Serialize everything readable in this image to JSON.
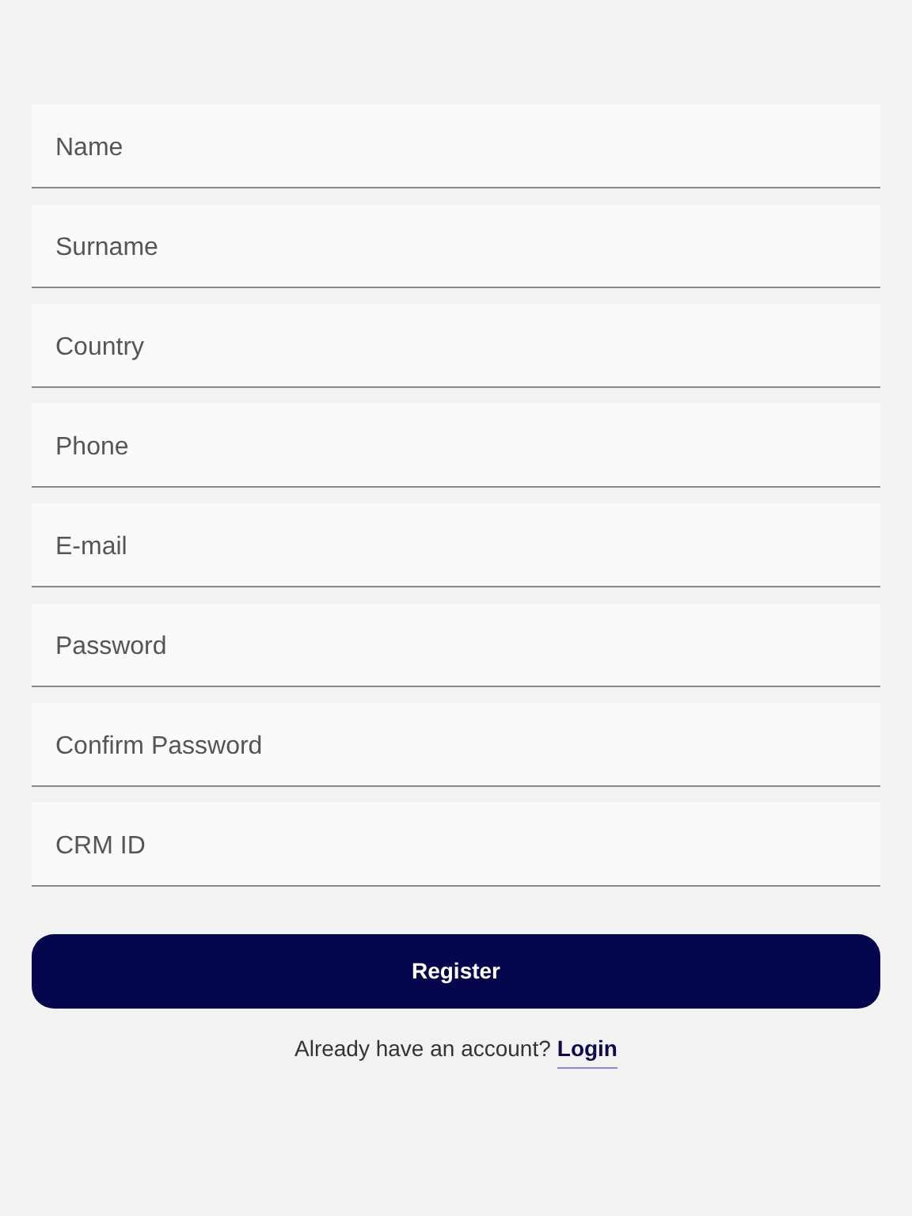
{
  "fields": [
    {
      "placeholder": "Name"
    },
    {
      "placeholder": "Surname"
    },
    {
      "placeholder": "Country"
    },
    {
      "placeholder": "Phone"
    },
    {
      "placeholder": "E-mail"
    },
    {
      "placeholder": "Password"
    },
    {
      "placeholder": "Confirm Password"
    },
    {
      "placeholder": "CRM ID"
    }
  ],
  "register_button": "Register",
  "login_prompt": {
    "text": "Already have an account?",
    "link": "Login"
  }
}
